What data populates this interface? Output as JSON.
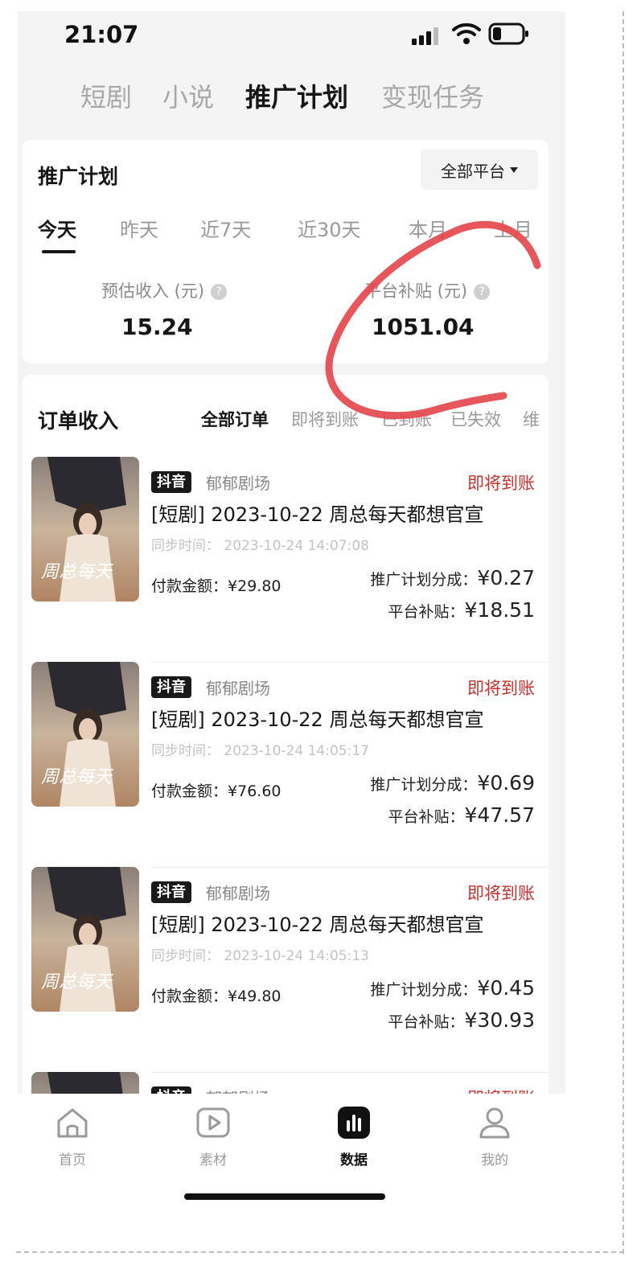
{
  "status_bar": {
    "time": "21:07"
  },
  "top_tabs": [
    "短剧",
    "小说",
    "推广计划",
    "变现任务"
  ],
  "plan_card": {
    "title": "推广计划",
    "platform_filter": "全部平台",
    "periods": [
      "今天",
      "昨天",
      "近7天",
      "近30天",
      "本月",
      "上月"
    ],
    "metrics": [
      {
        "label": "预估收入 (元)",
        "value": "15.24"
      },
      {
        "label": "平台补贴 (元)",
        "value": "1051.04"
      }
    ]
  },
  "orders_card": {
    "title": "订单收入",
    "filters": [
      "全部订单",
      "即将到账",
      "已到账",
      "已失效",
      "维"
    ],
    "labels": {
      "pay": "付款金额：",
      "share": "推广计划分成：",
      "subsidy": "平台补贴：",
      "sync": "同步时间："
    },
    "orders": [
      {
        "platform": "抖音",
        "source": "郁郁剧场",
        "status": "即将到账",
        "title": "[短剧] 2023-10-22 周总每天都想官宣",
        "sync_time": "2023-10-24 14:07:08",
        "pay_amount": "¥29.80",
        "share_amount": "¥0.27",
        "subsidy_amount": "¥18.51"
      },
      {
        "platform": "抖音",
        "source": "郁郁剧场",
        "status": "即将到账",
        "title": "[短剧] 2023-10-22 周总每天都想官宣",
        "sync_time": "2023-10-24 14:05:17",
        "pay_amount": "¥76.60",
        "share_amount": "¥0.69",
        "subsidy_amount": "¥47.57"
      },
      {
        "platform": "抖音",
        "source": "郁郁剧场",
        "status": "即将到账",
        "title": "[短剧] 2023-10-22 周总每天都想官宣",
        "sync_time": "2023-10-24 14:05:13",
        "pay_amount": "¥49.80",
        "share_amount": "¥0.45",
        "subsidy_amount": "¥30.93"
      },
      {
        "platform": "抖音",
        "source": "郁郁剧场",
        "status": "即将到账"
      }
    ]
  },
  "bottom_nav": [
    {
      "label": "首页",
      "icon": "home-icon"
    },
    {
      "label": "素材",
      "icon": "video-play-icon"
    },
    {
      "label": "数据",
      "icon": "bar-chart-icon"
    },
    {
      "label": "我的",
      "icon": "person-icon"
    }
  ],
  "colors": {
    "status_red": "#c7302c",
    "annotation_red": "#e5484d"
  }
}
